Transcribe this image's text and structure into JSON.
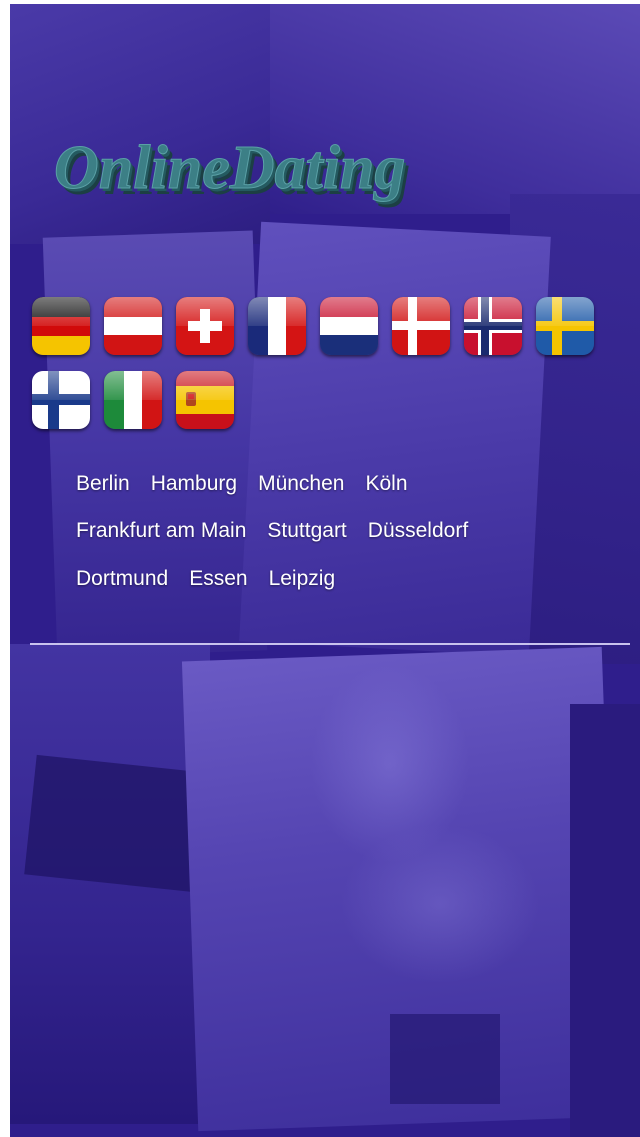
{
  "logo": {
    "text": "OnlineDating"
  },
  "flags": [
    {
      "icon": "germany-flag-icon"
    },
    {
      "icon": "austria-flag-icon"
    },
    {
      "icon": "switzerland-flag-icon"
    },
    {
      "icon": "france-flag-icon"
    },
    {
      "icon": "netherlands-flag-icon"
    },
    {
      "icon": "denmark-flag-icon"
    },
    {
      "icon": "norway-flag-icon"
    },
    {
      "icon": "sweden-flag-icon"
    },
    {
      "icon": "finland-flag-icon"
    },
    {
      "icon": "italy-flag-icon"
    },
    {
      "icon": "spain-flag-icon"
    }
  ],
  "cities": {
    "row1": [
      "Berlin",
      "Hamburg",
      "München",
      "Köln"
    ],
    "row2": [
      "Frankfurt am Main",
      "Stuttgart",
      "Düsseldorf"
    ],
    "row3": [
      "Dortmund",
      "Essen",
      "Leipzig"
    ]
  },
  "colors": {
    "background": "#2f1e8c",
    "logo_fill": "#3c7f86",
    "link": "#ffffff",
    "divider": "#c9c3ee"
  }
}
